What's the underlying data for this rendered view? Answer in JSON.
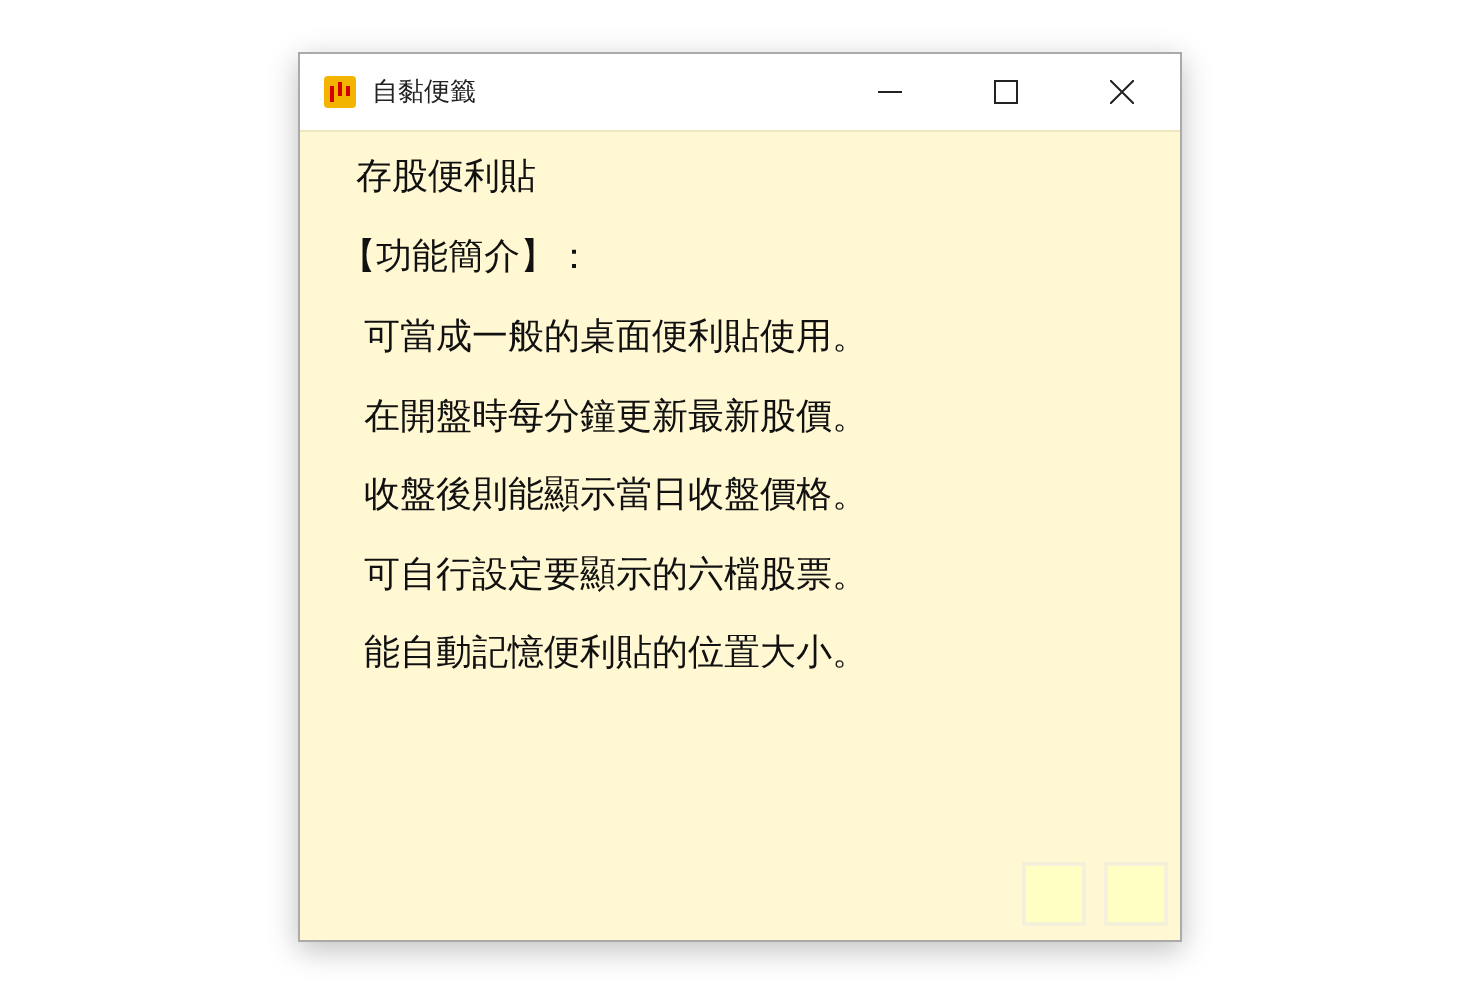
{
  "window": {
    "title": "自黏便籤"
  },
  "note": {
    "heading": "存股便利貼",
    "section": "【功能簡介】：",
    "lines": [
      "可當成一般的桌面便利貼使用。",
      "在開盤時每分鐘更新最新股價。",
      "收盤後則能顯示當日收盤價格。",
      "可自行設定要顯示的六檔股票。",
      "能自動記憶便利貼的位置大小。"
    ]
  }
}
